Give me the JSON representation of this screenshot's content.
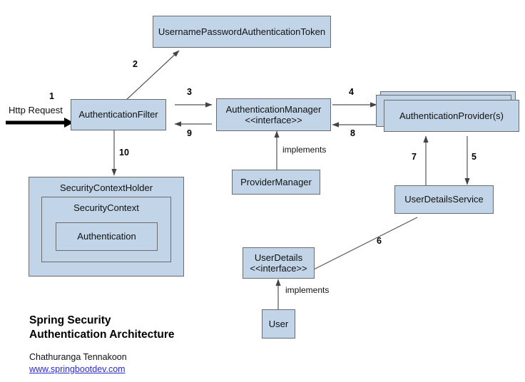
{
  "diagram": {
    "title_lines": "Spring Security\nAuthentication Architecture",
    "author": "Chathuranga Tennakoon",
    "website": "www.springbootdev.com",
    "colors": {
      "node_fill": "#c2d4e8",
      "node_border": "#6b6b6b",
      "link": "#2a2ad0",
      "arrow": "#444444",
      "request_arrow": "#000000",
      "background": "#ffffff"
    },
    "nodes": {
      "username_password_token": "UsernamePasswordAuthenticationToken",
      "authentication_filter": "AuthenticationFilter",
      "authentication_manager": "AuthenticationManager\n<<interface>>",
      "authentication_providers": "AuthenticationProvider(s)",
      "provider_manager": "ProviderManager",
      "user_details_service": "UserDetailsService",
      "user_details": "UserDetails\n<<interface>>",
      "user": "User",
      "security_context_holder": "SecurityContextHolder",
      "security_context": "SecurityContext",
      "authentication": "Authentication"
    },
    "entry": {
      "request_label": "Http Request",
      "request_step": "1"
    },
    "steps": {
      "s2": "2",
      "s3": "3",
      "s4": "4",
      "s5": "5",
      "s6": "6",
      "s7": "7",
      "s8": "8",
      "s9": "9",
      "s10": "10"
    },
    "relations": {
      "implements_manager": "implements",
      "implements_user": "implements"
    }
  }
}
